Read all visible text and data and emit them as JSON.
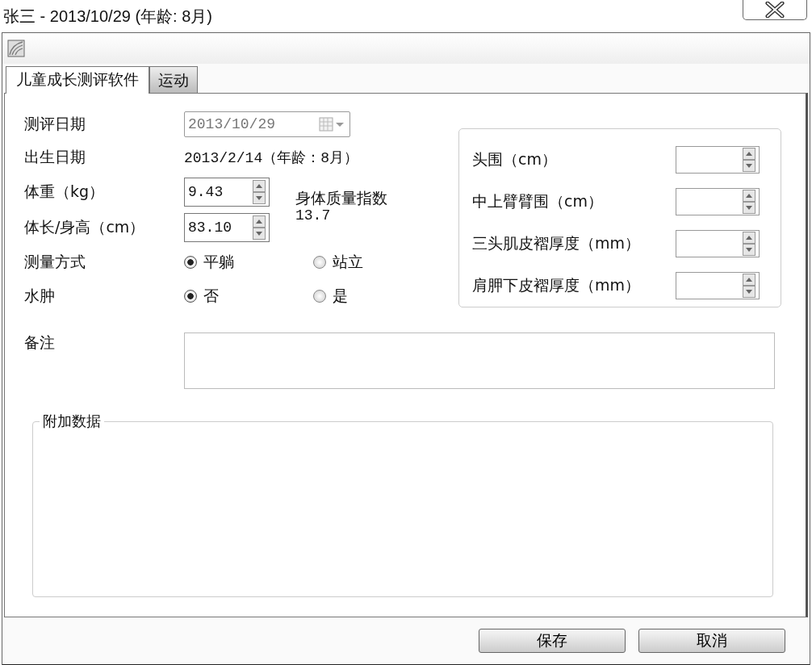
{
  "window": {
    "title": "张三 - 2013/10/29 (年龄: 8月)"
  },
  "tabs": [
    {
      "label": "儿童成长测评软件",
      "selected": true
    },
    {
      "label": "运动",
      "selected": false
    }
  ],
  "form": {
    "assessment_date": {
      "label": "测评日期",
      "value": "2013/10/29",
      "disabled": true
    },
    "birth_date": {
      "label": "出生日期",
      "value": "2013/2/14（年龄：8月）"
    },
    "weight": {
      "label": "体重（kg）",
      "value": "9.43"
    },
    "height": {
      "label": "体长/身高（cm）",
      "value": "83.10"
    },
    "bmi": {
      "label": "身体质量指数",
      "value": "13.7"
    },
    "radio_groups": [
      {
        "label": "测量方式",
        "options": [
          {
            "label": "平躺",
            "selected": true
          },
          {
            "label": "站立",
            "selected": false
          }
        ]
      },
      {
        "label": "水肿",
        "options": [
          {
            "label": "否",
            "selected": true
          },
          {
            "label": "是",
            "selected": false
          }
        ]
      }
    ],
    "notes": {
      "label": "备注"
    }
  },
  "measurements": [
    {
      "label": "头围（cm）"
    },
    {
      "label": "中上臂臂围（cm）"
    },
    {
      "label": "三头肌皮褶厚度（mm）"
    },
    {
      "label": "肩胛下皮褶厚度（mm）"
    }
  ],
  "additional_data": {
    "title": "附加数据"
  },
  "buttons": [
    "保存",
    "取消"
  ]
}
